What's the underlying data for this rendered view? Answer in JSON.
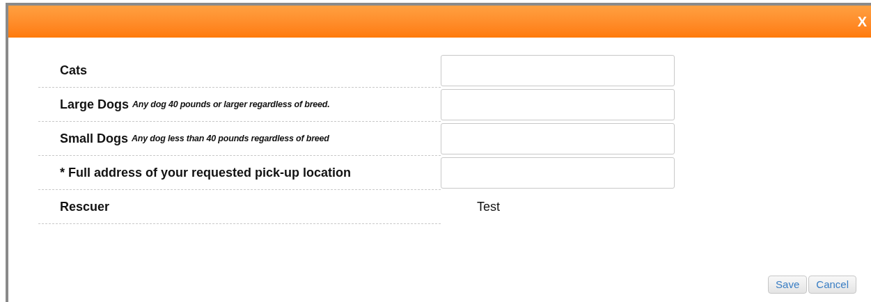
{
  "dialog": {
    "close": "X"
  },
  "rows": [
    {
      "kind": "input",
      "label": "Cats"
    },
    {
      "kind": "input",
      "label": "Large Dogs",
      "hint": "Any dog 40 pounds or larger regardless of breed."
    },
    {
      "kind": "input",
      "label": "Small Dogs",
      "hint": "Any dog less than 40 pounds regardless of breed"
    },
    {
      "kind": "input",
      "label": "* Full address of your requested pick-up location"
    },
    {
      "kind": "text",
      "label": "Rescuer",
      "value": "Test"
    }
  ],
  "buttons": [
    "Save",
    "Cancel"
  ]
}
